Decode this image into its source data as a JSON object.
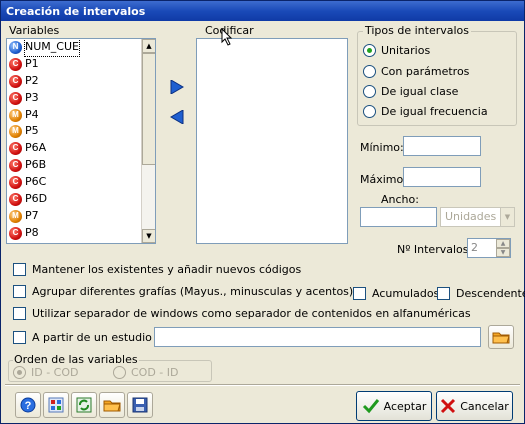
{
  "window": {
    "title": "Creación de intervalos"
  },
  "variables": {
    "label": "Variables",
    "items": [
      {
        "badge": "N",
        "name": "NUM_CUE"
      },
      {
        "badge": "C",
        "name": "P1"
      },
      {
        "badge": "C",
        "name": "P2"
      },
      {
        "badge": "C",
        "name": "P3"
      },
      {
        "badge": "M",
        "name": "P4"
      },
      {
        "badge": "M",
        "name": "P5"
      },
      {
        "badge": "C",
        "name": "P6A"
      },
      {
        "badge": "C",
        "name": "P6B"
      },
      {
        "badge": "C",
        "name": "P6C"
      },
      {
        "badge": "C",
        "name": "P6D"
      },
      {
        "badge": "M",
        "name": "P7"
      },
      {
        "badge": "C",
        "name": "P8"
      }
    ]
  },
  "codificar": {
    "label": "Codificar"
  },
  "tipos": {
    "label": "Tipos de intervalos",
    "options": [
      "Unitarios",
      "Con parámetros",
      "De igual clase",
      "De igual frecuencia"
    ],
    "selected_index": 0
  },
  "fields": {
    "minimo_label": "Mínimo:",
    "maximo_label": "Máximo:",
    "ancho_label": "Ancho:",
    "unidades_value": "Unidades",
    "intervalos_label": "Nº Intervalos:",
    "intervalos_value": "2"
  },
  "options": {
    "mantener": "Mantener los existentes y añadir nuevos códigos",
    "agrupar": "Agrupar diferentes grafías (Mayus., minusculas y acentos)",
    "acumulados": "Acumulados",
    "descendente": "Descendente",
    "separador": "Utilizar separador de windows como separador de contenidos en alfanuméricas",
    "estudio": "A partir de un estudio"
  },
  "orden": {
    "label": "Orden de las variables",
    "opt1": "ID - COD",
    "opt2": "COD - ID"
  },
  "buttons": {
    "aceptar": "Aceptar",
    "cancelar": "Cancelar"
  },
  "colors": {
    "title_bar": "#1a4ab8",
    "move_arrow": "#1f5fd0"
  }
}
